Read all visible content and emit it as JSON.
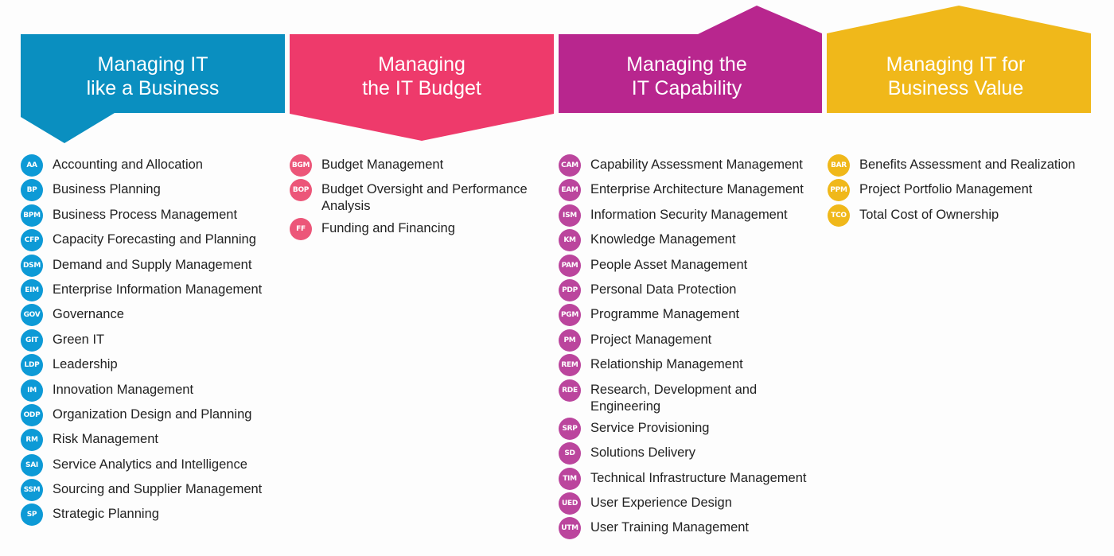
{
  "columns": [
    {
      "title_lines": [
        "Managing IT",
        "like a Business"
      ],
      "color": "#0a8fc0",
      "badge_color": "#0d9ad6",
      "items": [
        {
          "code": "AA",
          "label": "Accounting and Allocation"
        },
        {
          "code": "BP",
          "label": "Business Planning"
        },
        {
          "code": "BPM",
          "label": "Business Process Management"
        },
        {
          "code": "CFP",
          "label": "Capacity Forecasting and Planning"
        },
        {
          "code": "DSM",
          "label": "Demand and Supply Management"
        },
        {
          "code": "EIM",
          "label": "Enterprise Information Management"
        },
        {
          "code": "GOV",
          "label": "Governance"
        },
        {
          "code": "GIT",
          "label": "Green IT"
        },
        {
          "code": "LDP",
          "label": "Leadership"
        },
        {
          "code": "IM",
          "label": "Innovation Management"
        },
        {
          "code": "ODP",
          "label": "Organization Design and Planning"
        },
        {
          "code": "RM",
          "label": "Risk Management"
        },
        {
          "code": "SAI",
          "label": "Service Analytics and Intelligence"
        },
        {
          "code": "SSM",
          "label": "Sourcing and Supplier Management"
        },
        {
          "code": "SP",
          "label": "Strategic Planning"
        }
      ]
    },
    {
      "title_lines": [
        "Managing",
        "the IT Budget"
      ],
      "color": "#ee3a6b",
      "badge_color": "#ec5679",
      "items": [
        {
          "code": "BGM",
          "label": "Budget Management"
        },
        {
          "code": "BOP",
          "label": "Budget Oversight and Performance Analysis"
        },
        {
          "code": "FF",
          "label": "Funding and Financing"
        }
      ]
    },
    {
      "title_lines": [
        "Managing the",
        "IT Capability"
      ],
      "color": "#b8268e",
      "badge_color": "#bb459d",
      "items": [
        {
          "code": "CAM",
          "label": "Capability Assessment Management"
        },
        {
          "code": "EAM",
          "label": "Enterprise Architecture Management"
        },
        {
          "code": "ISM",
          "label": "Information Security Management"
        },
        {
          "code": "KM",
          "label": "Knowledge Management"
        },
        {
          "code": "PAM",
          "label": "People Asset Management"
        },
        {
          "code": "PDP",
          "label": "Personal Data Protection"
        },
        {
          "code": "PGM",
          "label": "Programme Management"
        },
        {
          "code": "PM",
          "label": "Project Management"
        },
        {
          "code": "REM",
          "label": "Relationship Management"
        },
        {
          "code": "RDE",
          "label": "Research, Development and Engineering"
        },
        {
          "code": "SRP",
          "label": "Service Provisioning"
        },
        {
          "code": "SD",
          "label": "Solutions Delivery"
        },
        {
          "code": "TIM",
          "label": "Technical Infrastructure Management"
        },
        {
          "code": "UED",
          "label": "User Experience Design"
        },
        {
          "code": "UTM",
          "label": "User Training Management"
        }
      ]
    },
    {
      "title_lines": [
        "Managing IT for",
        "Business Value"
      ],
      "color": "#f0b81a",
      "badge_color": "#f0b81a",
      "items": [
        {
          "code": "BAR",
          "label": "Benefits Assessment and Realization"
        },
        {
          "code": "PPM",
          "label": "Project Portfolio Management"
        },
        {
          "code": "TCO",
          "label": "Total Cost of Ownership"
        }
      ]
    }
  ]
}
